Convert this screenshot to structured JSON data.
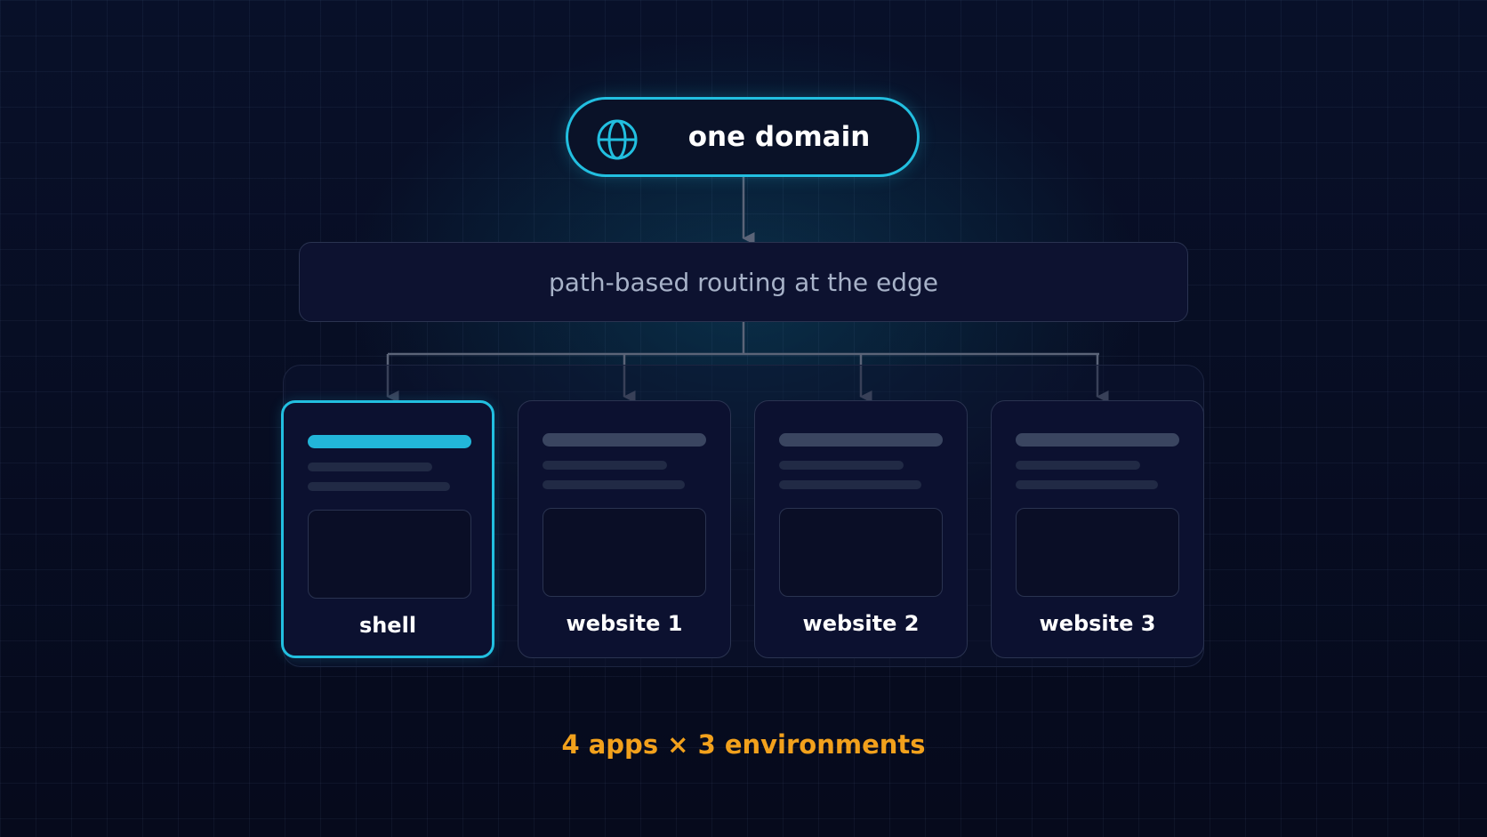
{
  "domain_node": {
    "label": "one domain",
    "icon": "globe-icon"
  },
  "routing_node": {
    "label": "path-based routing at the edge"
  },
  "apps": [
    {
      "label": "shell",
      "active": true
    },
    {
      "label": "website 1",
      "active": false
    },
    {
      "label": "website 2",
      "active": false
    },
    {
      "label": "website 3",
      "active": false
    }
  ],
  "footer": {
    "note": "4 apps × 3 environments"
  },
  "colors": {
    "background": "#070b1f",
    "accent": "#22bfe0",
    "connector": "#5b6478",
    "highlight_text": "#f2a11c",
    "muted_text": "#a7b2c8"
  }
}
